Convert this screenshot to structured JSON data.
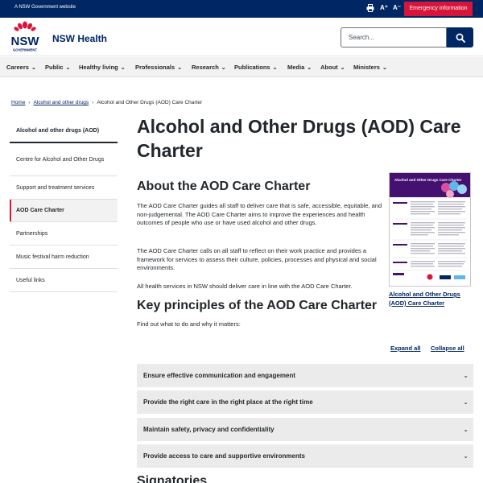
{
  "topbar": {
    "gov_text": "A NSW Government website",
    "emergency_label": "Emergency information",
    "increase_text": "A⁺",
    "decrease_text": "A⁻"
  },
  "header": {
    "logo_text": "NSW",
    "logo_subtext": "GOVERNMENT",
    "site_name": "NSW Health",
    "search_placeholder": "Search..."
  },
  "nav": {
    "items": [
      "Careers",
      "Public",
      "Healthy living",
      "Professionals",
      "Research",
      "Publications",
      "Media",
      "About",
      "Ministers"
    ]
  },
  "breadcrumb": {
    "items": [
      "Home",
      "Alcohol and other drugs",
      "Alcohol and Other Drugs (AOD) Care Charter"
    ]
  },
  "sidebar": {
    "items": [
      "Alcohol and other drugs (AOD)",
      "Centre for Alcohol and Other Drugs",
      "Support and treatment services",
      "AOD Care Charter",
      "Partnerships",
      "Music festival harm reduction",
      "Useful links"
    ]
  },
  "main": {
    "title": "Alcohol and Other Drugs (AOD) Care Charter",
    "about_heading": "About the AOD Care Charter",
    "about_p1": "The AOD Care Charter guides all staff to deliver care that is safe, accessible, equitable, and non-judgemental. The AOD Care Charter aims to improve the experiences and health outcomes of people who use or have used alcohol and other drugs.",
    "about_p2": "The AOD Care Charter calls on all staff to reflect on their work practice and provides a framework for services to assess their culture, policies, processes and physical and social environments.",
    "about_p3": "All health services in NSW should deliver care in line with the AOD Care Charter.",
    "doc_caption": "Alcohol and Other Drugs (AOD) Care Charter",
    "doc_thumb_title": "Alcohol and Other Drugs Care Charter",
    "principles_heading": "Key principles of the AOD Care Charter",
    "principles_intro": "Find out what to do and why it matters:",
    "expand_all": "Expand all",
    "collapse_all": "Collapse all",
    "accordion": [
      "Ensure effective communication and engagement",
      "Provide the right care in the right place at the right time",
      "Maintain safety, privacy and confidentiality",
      "Provide access to care and supportive environments"
    ],
    "signatories_heading": "Signatories"
  },
  "colors": {
    "navy": "#002664",
    "red": "#d7153a",
    "purple": "#441170",
    "grey_panel": "#ebebeb"
  }
}
